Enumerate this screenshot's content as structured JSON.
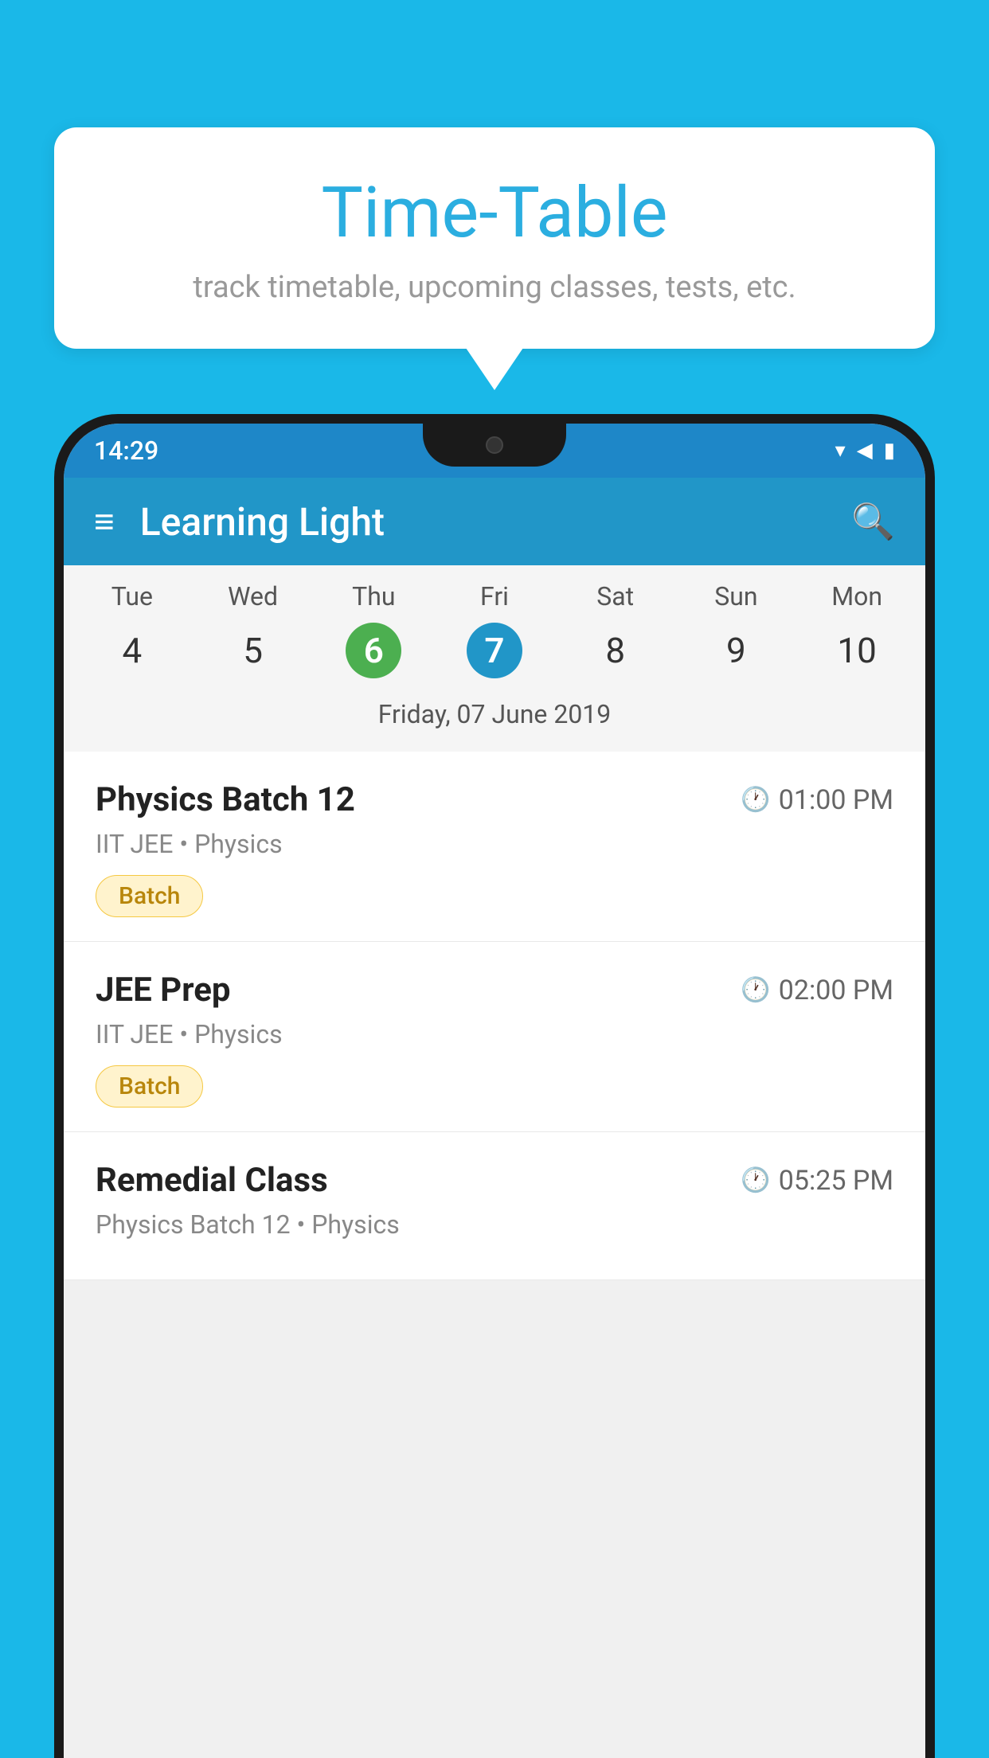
{
  "page": {
    "background_color": "#1ab8e8"
  },
  "speech_bubble": {
    "title": "Time-Table",
    "subtitle": "track timetable, upcoming classes, tests, etc."
  },
  "phone": {
    "status_bar": {
      "time": "14:29"
    },
    "app_bar": {
      "title": "Learning Light"
    },
    "calendar": {
      "day_names": [
        "Tue",
        "Wed",
        "Thu",
        "Fri",
        "Sat",
        "Sun",
        "Mon"
      ],
      "day_numbers": [
        "4",
        "5",
        "6",
        "7",
        "8",
        "9",
        "10"
      ],
      "today_index": 2,
      "selected_index": 3,
      "selected_date_label": "Friday, 07 June 2019"
    },
    "schedule": [
      {
        "title": "Physics Batch 12",
        "time": "01:00 PM",
        "subtitle": "IIT JEE • Physics",
        "badge": "Batch"
      },
      {
        "title": "JEE Prep",
        "time": "02:00 PM",
        "subtitle": "IIT JEE • Physics",
        "badge": "Batch"
      },
      {
        "title": "Remedial Class",
        "time": "05:25 PM",
        "subtitle": "Physics Batch 12 • Physics",
        "badge": null
      }
    ]
  },
  "icons": {
    "hamburger": "≡",
    "search": "🔍",
    "clock": "🕐",
    "wifi": "▾",
    "signal": "▲",
    "battery": "▮"
  }
}
